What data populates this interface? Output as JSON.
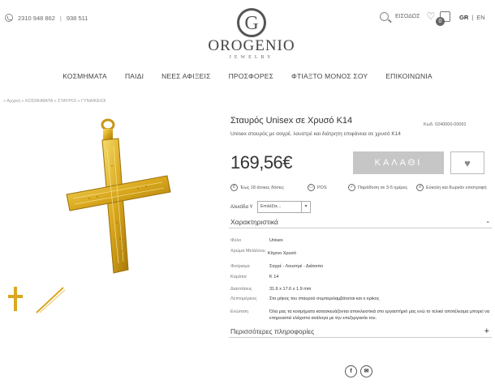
{
  "header": {
    "phone_main": "2310 948 862",
    "phone_alt": "938 511",
    "phone_sep": "|",
    "logo_name": "OROGENIO",
    "logo_sub": "JEWELRY",
    "login_label": "ΕΙΣΟΔΟΣ",
    "cart_count": "0",
    "lang_gr": "GR",
    "lang_sep": "|",
    "lang_en": "EN"
  },
  "nav": {
    "items": [
      "ΚΟΣΜΗΜΑΤΑ",
      "ΠΑΙΔΙ",
      "ΝΕΕΣ ΑΦΙΞΕΙΣ",
      "ΠΡΟΣΦΟΡΕΣ",
      "ΦΤΙΑΞΤΟ ΜΟΝΟΣ ΣΟΥ",
      "ΕΠΙΚΟΙΝΩΝΙΑ"
    ]
  },
  "breadcrumb": "» Αρχική » ΚΟΣΜΗΜΑΤΑ » ΣΤΑΥΡΟΙ » ΓΥΝΑΙΚΕΙΟΙ",
  "product": {
    "title": "Σταυρός Unisex σε Χρυσό K14",
    "code": "Κωδ. 0240000-00092",
    "subtitle": "Unisex σταυρός με σαγρέ, λουστρέ και διάτρητη επιφάνεια σε χρυσό K14",
    "price": "169,56€",
    "cart_label": "ΚΑΛΑΘΙ",
    "features": [
      {
        "icon": "€",
        "label": "Έως 18 άτοκες δόσεις"
      },
      {
        "icon": "▭",
        "label": "POS"
      },
      {
        "icon": "✓",
        "label": "Παράδοση σε 3-5 ημέρες"
      },
      {
        "icon": "↺",
        "label": "Εύκολη και δωρεάν επιστροφή"
      }
    ],
    "alloy_label": "Αλυσίδα Υ",
    "alloy_value": "Επιλέξτε...",
    "colors": {
      "gold": "#d9a81e",
      "gold_dark": "#b8860b",
      "gold_light": "#f3d25a"
    }
  },
  "specs": {
    "heading": "Χαρακτηριστικά",
    "toggle": "-",
    "rows": [
      {
        "key": "Φύλο",
        "value": "Unisex"
      },
      {
        "key": "Χρώμα Μετάλλου",
        "value": "Κίτρινο Χρυσό"
      },
      {
        "key": "Φινίρισμα",
        "value": "Σαγρέ - Λουστρέ - Διάτοιπο"
      },
      {
        "key": "Καράτια",
        "value": "K 14"
      },
      {
        "key": "Διαστάσεις",
        "value": "31.6 x 17.6 x 1.9 mm"
      },
      {
        "key": "Λεπτομέρειες",
        "value": "Στο μήκος του σταυρού συμπεριλαμβάνεται και ο κρίκος"
      },
      {
        "key": "Ενώπιση",
        "value": "Όλα μας τα κοσμήματα κατασκευάζονται αποκλειστικά στο εργαστήριό μας ενώ το τελικό αποτέλεσμα μπορεί να επηρεαστεί ελάχιστα ανάλογα με την επεξεργασία του."
      }
    ]
  },
  "more": {
    "heading": "Περισσότερες πληροφορίες",
    "toggle": "+"
  },
  "social": {
    "facebook": "f",
    "email": "✉"
  }
}
